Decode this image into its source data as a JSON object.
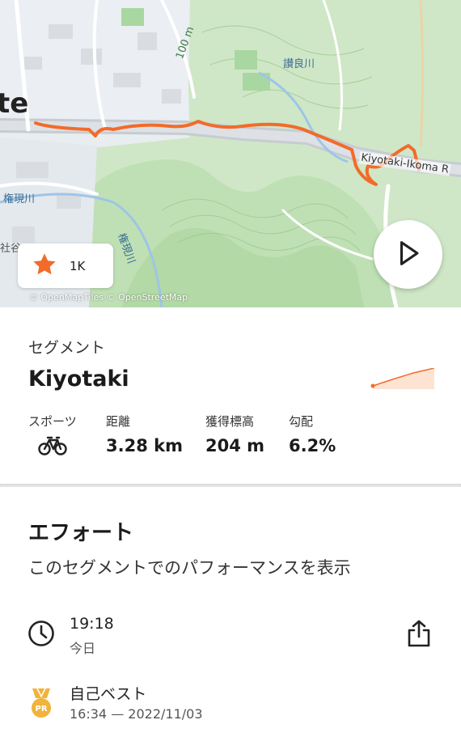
{
  "map": {
    "place_fragment": "te",
    "labels": {
      "gongen1": "権現川",
      "gongen2": "権現川",
      "sanuki": "讃良川",
      "contour": "100 m",
      "shatani": "社谷",
      "road": "Kiyotaki-Ikoma R"
    },
    "attribution": "© OpenMapTiles © OpenStreetMap",
    "route_color": "#f26b2a"
  },
  "kudos": {
    "count": "1K",
    "icon": "star-icon",
    "color": "#f26b2a"
  },
  "play_icon": "play-icon",
  "segment": {
    "eyebrow": "セグメント",
    "name": "Kiyotaki",
    "stats": {
      "sport_label": "スポーツ",
      "sport_icon": "bicycle-icon",
      "distance_label": "距離",
      "distance_value": "3.28 km",
      "elevation_label": "獲得標高",
      "elevation_value": "204 m",
      "grade_label": "勾配",
      "grade_value": "6.2%"
    }
  },
  "efforts": {
    "title": "エフォート",
    "subtitle": "このセグメントでのパフォーマンスを表示",
    "latest": {
      "time": "19:18",
      "date": "今日",
      "icon": "clock-icon"
    },
    "share_icon": "share-icon",
    "pr": {
      "label": "自己ベスト",
      "detail": "16:34 — 2022/11/03",
      "icon": "pr-medal-icon"
    }
  }
}
